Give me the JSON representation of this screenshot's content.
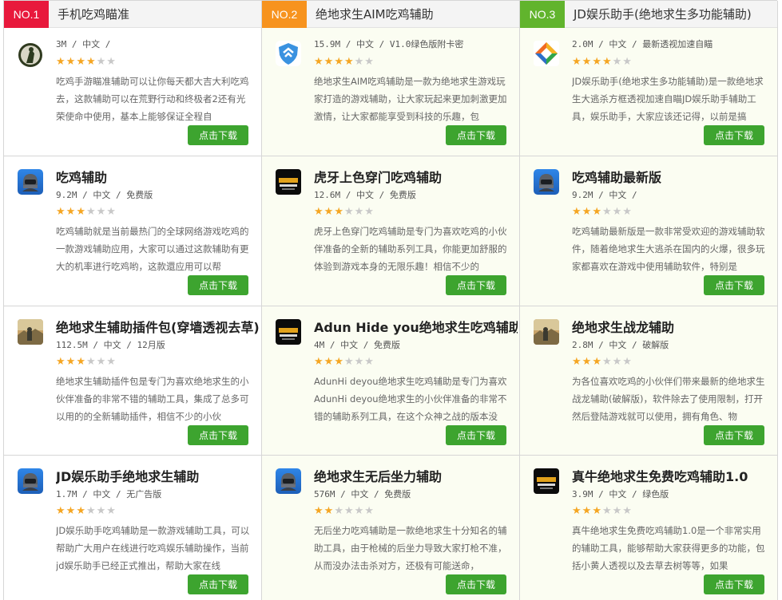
{
  "rank_badge_colors": [
    "#e8193c",
    "#f7931e",
    "#61b42d"
  ],
  "download_label": "点击下载",
  "cards": [
    {
      "rank": "NO.1",
      "title": "手机吃鸡瞄准",
      "meta": "3M / 中文 /",
      "stars": 4,
      "icon": "soldier-icon",
      "desc": "吃鸡手游瞄准辅助可以让你每天都大吉大利吃鸡去，这款辅助可以在荒野行动和终极者2还有光荣使命中使用，基本上能够保证全程自"
    },
    {
      "rank": "NO.2",
      "title": "绝地求生AIM吃鸡辅助",
      "meta": "15.9M / 中文 / V1.0绿色版附卡密",
      "stars": 4,
      "icon": "shield-icon",
      "desc": "绝地求生AIM吃鸡辅助是一款为绝地求生游戏玩家打造的游戏辅助，让大家玩起来更加刺激更加激情，让大家都能享受到科技的乐趣，包"
    },
    {
      "rank": "NO.3",
      "title": "JD娱乐助手(绝地求生多功能辅助)",
      "meta": "2.0M / 中文 / 最新透视加速自瞄",
      "stars": 4,
      "icon": "diamond-logo-icon",
      "desc": "JD娱乐助手(绝地求生多功能辅助)是一款绝地求生大逃杀方框透视加速自瞄JD娱乐助手辅助工具，娱乐助手，大家应该还记得，以前是搞"
    },
    {
      "title": "吃鸡辅助",
      "meta": "9.2M / 中文 / 免费版",
      "stars": 3,
      "icon": "helmet-icon",
      "desc": "吃鸡辅助就是当前最热门的全球网络游戏吃鸡的一款游戏辅助应用，大家可以通过这款辅助有更大的机率进行吃鸡哟，这款還应用可以帮"
    },
    {
      "title": "虎牙上色穿门吃鸡辅助",
      "meta": "12.6M / 中文 / 免费版",
      "stars": 3,
      "icon": "pubg-logo-icon",
      "desc": "虎牙上色穿门吃鸡辅助是专门为喜欢吃鸡的小伙伴准备的全新的辅助系列工具，你能更加舒服的体验到游戏本身的无限乐趣！相信不少的"
    },
    {
      "title": "吃鸡辅助最新版",
      "meta": "9.2M / 中文 /",
      "stars": 3,
      "icon": "helmet-icon",
      "desc": "吃鸡辅助最新版是一款非常受欢迎的游戏辅助软件，随着绝地求生大逃杀在国内的火爆，很多玩家都喜欢在游戏中使用辅助软件，特别是"
    },
    {
      "title": "绝地求生辅助插件包(穿墙透视去草)",
      "meta": "112.5M / 中文 / 12月版",
      "stars": 3,
      "icon": "game-scene-icon",
      "desc": "绝地求生辅助插件包是专门为喜欢绝地求生的小伙伴准备的非常不错的辅助工具，集成了总多可以用的的全新辅助插件，相信不少的小伙"
    },
    {
      "title": "Adun Hide you绝地求生吃鸡辅助",
      "meta": "4M / 中文 / 免费版",
      "stars": 3,
      "icon": "pubg-logo-icon",
      "desc": "AdunHi deyou绝地求生吃鸡辅助是专门为喜欢AdunHi deyou绝地求生的小伙伴准备的非常不错的辅助系列工具，在这个众神之战的版本没"
    },
    {
      "title": "绝地求生战龙辅助",
      "meta": "2.8M / 中文 / 破解版",
      "stars": 3,
      "icon": "game-scene-icon",
      "desc": "为各位喜欢吃鸡的小伙伴们带来最新的绝地求生战龙辅助(破解版)，软件除去了使用限制，打开然后登陆游戏就可以使用，拥有角色、物"
    },
    {
      "title": "JD娱乐助手绝地求生辅助",
      "meta": "1.7M / 中文 / 无广告版",
      "stars": 3,
      "icon": "helmet-icon",
      "desc": "JD娱乐助手吃鸡辅助是一款游戏辅助工具，可以帮助广大用户在线进行吃鸡娱乐辅助操作，当前jd娱乐助手已经正式推出，帮助大家在线"
    },
    {
      "title": "绝地求生无后坐力辅助",
      "meta": "576M / 中文 / 免费版",
      "stars": 2,
      "icon": "helmet-icon",
      "desc": "无后坐力吃鸡辅助是一款绝地求生十分知名的辅助工具，由于枪械的后坐力导致大家打枪不准，从而没办法击杀对方，还极有可能送命，"
    },
    {
      "title": "真牛绝地求生免费吃鸡辅助1.0",
      "meta": "3.9M / 中文 / 绿色版",
      "stars": 3,
      "icon": "pubg-logo-icon",
      "desc": "真牛绝地求生免费吃鸡辅助1.0是一个非常实用的辅助工具，能够帮助大家获得更多的功能，包括小黄人透视以及去草去树等等，如果"
    }
  ]
}
